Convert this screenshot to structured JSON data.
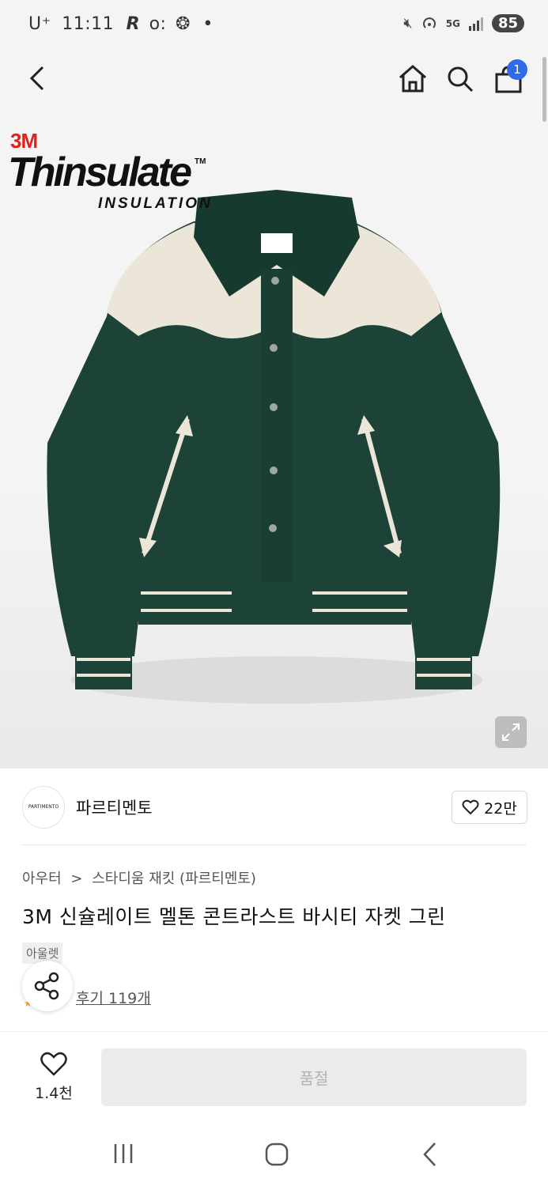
{
  "status_bar": {
    "carrier": "U⁺",
    "time": "11:11",
    "network": "5G",
    "battery": "85",
    "icons": [
      "r-app-icon",
      "key-icon",
      "settings-icon",
      "mute-icon",
      "hotspot-icon",
      "signal-icon"
    ]
  },
  "nav": {
    "icons": [
      "back-icon",
      "home-icon",
      "search-icon",
      "shopping-bag-icon"
    ],
    "cart_count": "1"
  },
  "hero": {
    "logo_brand": "3M",
    "logo_name": "Thinsulate",
    "logo_tm": "TM",
    "logo_sub": "INSULATION",
    "colors": {
      "jacket_green": "#1d4237",
      "jacket_cream": "#ece6d8"
    }
  },
  "brand": {
    "logo_text": "PARTIMENTO",
    "name": "파르티멘토",
    "likes": "22만"
  },
  "product": {
    "breadcrumb_parent": "아우터",
    "breadcrumb_child": "스타디움 재킷 (파르티멘토)",
    "title": "3M 신슐레이트 멜톤 콘트라스트 바시티 자켓 그린",
    "tag": "아울렛",
    "reviews": "후기 119개"
  },
  "bottom": {
    "wish_count": "1.4천",
    "buy_label": "품절"
  },
  "colors": {
    "accent_blue": "#2e6bea",
    "star": "#f5a623",
    "disabled_bg": "#ebebeb",
    "disabled_text": "#b3b3b3"
  }
}
